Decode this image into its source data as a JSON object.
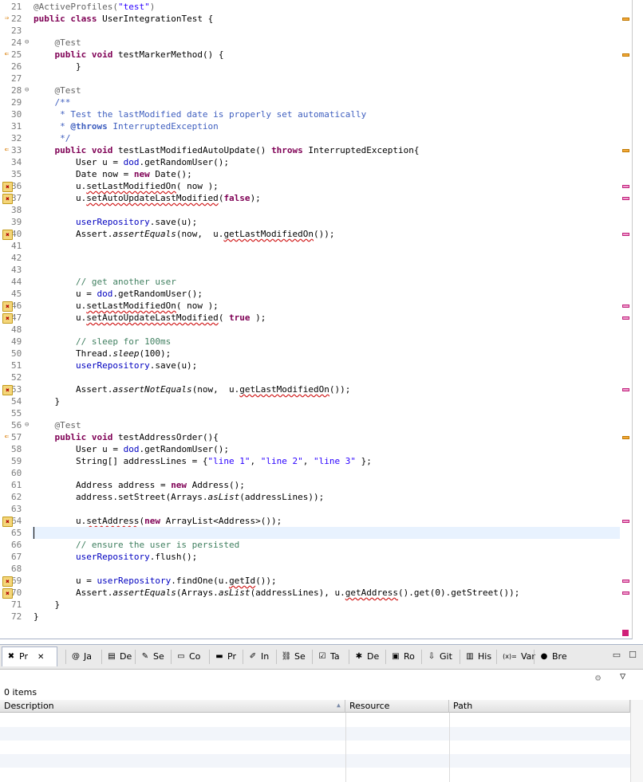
{
  "editor": {
    "lines": [
      {
        "n": "21",
        "fold": "",
        "mk": "",
        "html": "<span class=\"ann\">@ActiveProfiles(</span><span class=\"str\">\"test\"</span><span class=\"ann\">)</span>"
      },
      {
        "n": "22",
        "fold": "",
        "mk": "impl",
        "html": "<span class=\"kw\">public</span> <span class=\"kw\">class</span> UserIntegrationTest {"
      },
      {
        "n": "23",
        "fold": "",
        "mk": "",
        "html": ""
      },
      {
        "n": "24",
        "fold": "⊖",
        "mk": "",
        "html": "    <span class=\"ann\">@Test</span>"
      },
      {
        "n": "25",
        "fold": "",
        "mk": "override",
        "html": "    <span class=\"kw\">public</span> <span class=\"kw\">void</span> testMarkerMethod() {"
      },
      {
        "n": "26",
        "fold": "",
        "mk": "",
        "html": "        }"
      },
      {
        "n": "27",
        "fold": "",
        "mk": "",
        "html": ""
      },
      {
        "n": "28",
        "fold": "⊖",
        "mk": "",
        "html": "    <span class=\"ann\">@Test</span>"
      },
      {
        "n": "29",
        "fold": "",
        "mk": "",
        "html": "    <span class=\"jd\">/**</span>"
      },
      {
        "n": "30",
        "fold": "",
        "mk": "",
        "html": "<span class=\"jd\">     * Test the lastModified date is properly set automatically</span>"
      },
      {
        "n": "31",
        "fold": "",
        "mk": "",
        "html": "<span class=\"jd\">     * <b>@throws</b> InterruptedException</span>"
      },
      {
        "n": "32",
        "fold": "",
        "mk": "",
        "html": "<span class=\"jd\">     */</span>"
      },
      {
        "n": "33",
        "fold": "",
        "mk": "override",
        "html": "    <span class=\"kw\">public</span> <span class=\"kw\">void</span> testLastModifiedAutoUpdate() <span class=\"kw\">throws</span> InterruptedException{"
      },
      {
        "n": "34",
        "fold": "",
        "mk": "",
        "html": "        User u = <span class=\"fld\">dod</span>.getRandomUser();"
      },
      {
        "n": "35",
        "fold": "",
        "mk": "",
        "html": "        Date now = <span class=\"kw\">new</span> Date();"
      },
      {
        "n": "36",
        "fold": "",
        "mk": "warn",
        "html": "        u.<span class=\"err\">setLastModifiedOn</span>( now );"
      },
      {
        "n": "37",
        "fold": "",
        "mk": "warn",
        "html": "        u.<span class=\"err\">setAutoUpdateLastModified</span>(<span class=\"kw\">false</span>);"
      },
      {
        "n": "38",
        "fold": "",
        "mk": "",
        "html": ""
      },
      {
        "n": "39",
        "fold": "",
        "mk": "",
        "html": "        <span class=\"fld\">userRepository</span>.save(u);"
      },
      {
        "n": "40",
        "fold": "",
        "mk": "warn",
        "html": "        Assert.<span class=\"it\">assertEquals</span>(now,  u.<span class=\"err\">getLastModifiedOn</span>());"
      },
      {
        "n": "41",
        "fold": "",
        "mk": "",
        "html": ""
      },
      {
        "n": "42",
        "fold": "",
        "mk": "",
        "html": ""
      },
      {
        "n": "43",
        "fold": "",
        "mk": "",
        "html": ""
      },
      {
        "n": "44",
        "fold": "",
        "mk": "",
        "html": "        <span class=\"cm\">// get another user</span>"
      },
      {
        "n": "45",
        "fold": "",
        "mk": "",
        "html": "        u = <span class=\"fld\">dod</span>.getRandomUser();"
      },
      {
        "n": "46",
        "fold": "",
        "mk": "warn",
        "html": "        u.<span class=\"err\">setLastModifiedOn</span>( now );"
      },
      {
        "n": "47",
        "fold": "",
        "mk": "warn",
        "html": "        u.<span class=\"err\">setAutoUpdateLastModified</span>( <span class=\"kw\">true</span> );"
      },
      {
        "n": "48",
        "fold": "",
        "mk": "",
        "html": ""
      },
      {
        "n": "49",
        "fold": "",
        "mk": "",
        "html": "        <span class=\"cm\">// sleep for 100ms</span>"
      },
      {
        "n": "50",
        "fold": "",
        "mk": "",
        "html": "        Thread.<span class=\"it\">sleep</span>(100);"
      },
      {
        "n": "51",
        "fold": "",
        "mk": "",
        "html": "        <span class=\"fld\">userRepository</span>.save(u);"
      },
      {
        "n": "52",
        "fold": "",
        "mk": "",
        "html": ""
      },
      {
        "n": "53",
        "fold": "",
        "mk": "warn",
        "html": "        Assert.<span class=\"it\">assertNotEquals</span>(now,  u.<span class=\"err\">getLastModifiedOn</span>());"
      },
      {
        "n": "54",
        "fold": "",
        "mk": "",
        "html": "    }"
      },
      {
        "n": "55",
        "fold": "",
        "mk": "",
        "html": ""
      },
      {
        "n": "56",
        "fold": "⊖",
        "mk": "",
        "html": "    <span class=\"ann\">@Test</span>"
      },
      {
        "n": "57",
        "fold": "",
        "mk": "override",
        "html": "    <span class=\"kw\">public</span> <span class=\"kw\">void</span> testAddressOrder(){"
      },
      {
        "n": "58",
        "fold": "",
        "mk": "",
        "html": "        User u = <span class=\"fld\">dod</span>.getRandomUser();"
      },
      {
        "n": "59",
        "fold": "",
        "mk": "",
        "html": "        String[] addressLines = {<span class=\"str\">\"line 1\"</span>, <span class=\"str\">\"line 2\"</span>, <span class=\"str\">\"line 3\"</span> };"
      },
      {
        "n": "60",
        "fold": "",
        "mk": "",
        "html": ""
      },
      {
        "n": "61",
        "fold": "",
        "mk": "",
        "html": "        Address address = <span class=\"kw\">new</span> Address();"
      },
      {
        "n": "62",
        "fold": "",
        "mk": "",
        "html": "        address.setStreet(Arrays.<span class=\"it\">asList</span>(addressLines));"
      },
      {
        "n": "63",
        "fold": "",
        "mk": "",
        "html": ""
      },
      {
        "n": "64",
        "fold": "",
        "mk": "warn",
        "html": "        u.<span class=\"err\">setAddress</span>(<span class=\"kw\">new</span> ArrayList&lt;Address&gt;());"
      },
      {
        "n": "65",
        "fold": "",
        "mk": "",
        "html": ""
      },
      {
        "n": "66",
        "fold": "",
        "mk": "",
        "html": "        <span class=\"cm\">// ensure the user is persisted</span>"
      },
      {
        "n": "67",
        "fold": "",
        "mk": "",
        "html": "        <span class=\"fld\">userRepository</span>.flush();"
      },
      {
        "n": "68",
        "fold": "",
        "mk": "",
        "html": ""
      },
      {
        "n": "69",
        "fold": "",
        "mk": "warn",
        "html": "        u = <span class=\"fld\">userRepository</span>.findOne(u.<span class=\"err\">getId</span>());"
      },
      {
        "n": "70",
        "fold": "",
        "mk": "warn",
        "html": "        Assert.<span class=\"it\">assertEquals</span>(Arrays.<span class=\"it\">asList</span>(addressLines), u.<span class=\"err\">getAddress</span>().get(0).getStreet());"
      },
      {
        "n": "71",
        "fold": "",
        "mk": "",
        "html": "    }"
      },
      {
        "n": "72",
        "fold": "",
        "mk": "",
        "html": "}"
      }
    ]
  },
  "view": {
    "tabs": [
      {
        "icon": "problems-icon",
        "glyph": "✖",
        "label": "Pr",
        "close": "✕",
        "active": true
      },
      {
        "icon": "javadoc-icon",
        "glyph": "@",
        "label": "Ja"
      },
      {
        "icon": "declaration-icon",
        "glyph": "▤",
        "label": "De"
      },
      {
        "icon": "search-icon",
        "glyph": "✎",
        "label": "Se"
      },
      {
        "icon": "console-icon",
        "glyph": "▭",
        "label": "Co"
      },
      {
        "icon": "progress-icon",
        "glyph": "▬",
        "label": "Pr"
      },
      {
        "icon": "infer-icon",
        "glyph": "✐",
        "label": "In"
      },
      {
        "icon": "servers-icon",
        "glyph": "⛓",
        "label": "Se"
      },
      {
        "icon": "tasks-icon",
        "glyph": "☑",
        "label": "Ta"
      },
      {
        "icon": "debug-icon",
        "glyph": "✱",
        "label": "De"
      },
      {
        "icon": "roo-icon",
        "glyph": "▣",
        "label": "Ro"
      },
      {
        "icon": "git-icon",
        "glyph": "⇩",
        "label": "Git"
      },
      {
        "icon": "history-icon",
        "glyph": "▥",
        "label": "His"
      },
      {
        "icon": "variables-icon",
        "glyph": "(x)=",
        "label": "Var"
      },
      {
        "icon": "breakpoints-icon",
        "glyph": "●",
        "label": "Bre"
      }
    ],
    "minimize": "▭",
    "maximize": "☐",
    "menu": "▽",
    "count": "0 items",
    "columns": [
      "Description",
      "Resource",
      "Path"
    ]
  }
}
